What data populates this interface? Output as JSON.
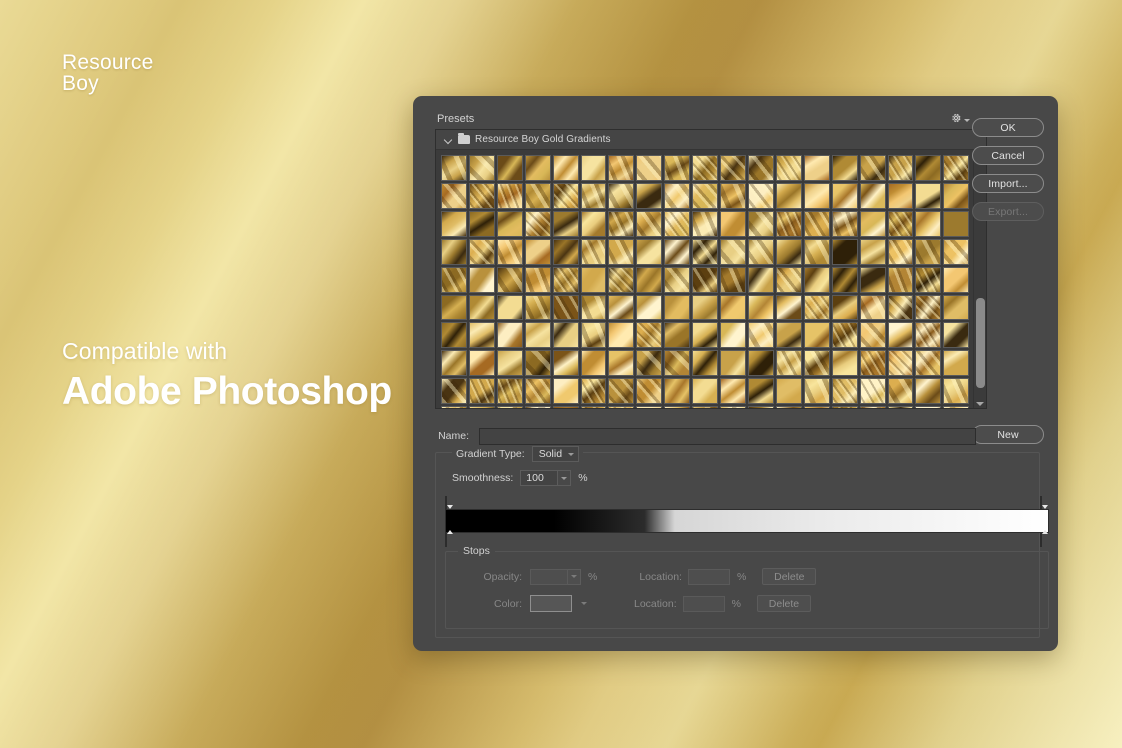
{
  "background": {
    "colors": [
      "#e8d68a",
      "#b8923f",
      "#f5ecb0",
      "#c8a84e"
    ]
  },
  "marketing": {
    "brand_line1": "Resource",
    "brand_line2": "Boy",
    "compat_small": "Compatible with",
    "compat_big": "Adobe Photoshop"
  },
  "dialog": {
    "presets_label": "Presets",
    "gear_icon": "gear-icon",
    "folder": {
      "chevron": "chevron-down-icon",
      "icon": "folder-icon",
      "name": "Resource Boy Gold Gradients"
    },
    "buttons": [
      {
        "label": "OK",
        "name": "ok-button",
        "disabled": false
      },
      {
        "label": "Cancel",
        "name": "cancel-button",
        "disabled": false
      },
      {
        "label": "Import...",
        "name": "import-button",
        "disabled": false
      },
      {
        "label": "Export...",
        "name": "export-button",
        "disabled": true
      }
    ],
    "new_button": "New",
    "name_field": {
      "label": "Name:",
      "value": "",
      "placeholder": ""
    },
    "gradient_type": {
      "label": "Gradient Type:",
      "value": "Solid"
    },
    "smoothness": {
      "label": "Smoothness:",
      "value": "100",
      "unit": "%"
    },
    "stops": {
      "title": "Stops",
      "opacity_label": "Opacity:",
      "opacity_value": "",
      "opacity_unit": "%",
      "color_label": "Color:",
      "location_label": "Location:",
      "location_value": "",
      "location_unit": "%",
      "delete_label": "Delete"
    },
    "scrollbar": {
      "up_icon": "scroll-up-arrow-icon",
      "down_icon": "scroll-down-arrow-icon"
    },
    "grid": {
      "columns": 19,
      "rows": 10,
      "swatch_count": 190
    }
  }
}
